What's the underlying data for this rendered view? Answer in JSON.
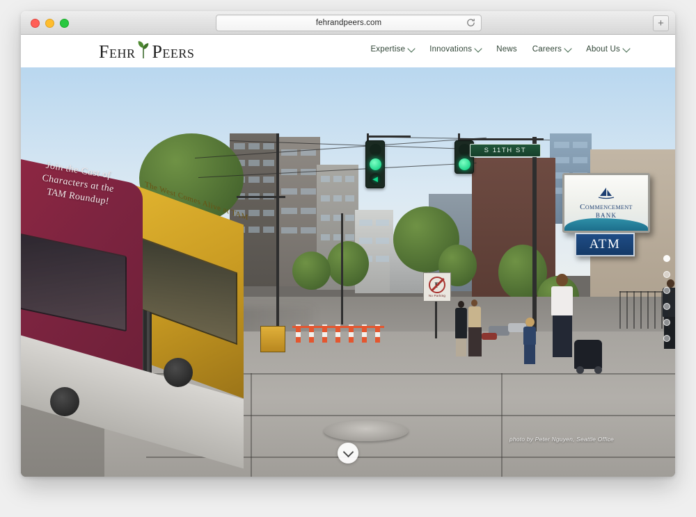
{
  "browser": {
    "url": "fehrandpeers.com",
    "reload_icon": "reload-icon",
    "new_tab_label": "+",
    "traffic_lights": [
      "close",
      "minimize",
      "zoom"
    ]
  },
  "site": {
    "logo": {
      "word1": "Fehr",
      "word2": "Peers",
      "mark": "leaf-mark"
    },
    "nav": [
      {
        "label": "Expertise",
        "has_dropdown": true
      },
      {
        "label": "Innovations",
        "has_dropdown": true
      },
      {
        "label": "News",
        "has_dropdown": false
      },
      {
        "label": "Careers",
        "has_dropdown": true
      },
      {
        "label": "About Us",
        "has_dropdown": true
      }
    ],
    "nav_color": "#2f4435"
  },
  "hero": {
    "photo_credit": "photo by Peter Nguyen, Seattle Office",
    "scroll_hint_icon": "chevron-down-icon",
    "slide_dots": 6,
    "active_dot": 0,
    "scene": {
      "tram_ad_line1": "Join the Cast of",
      "tram_ad_line2": "Characters at the",
      "tram_ad_line3": "TAM Roundup!",
      "tram_gold_text": "The West Comes Alive at TAM",
      "street_sign": "S 11TH ST",
      "bank_sign_name": "Commencement",
      "bank_sign_sub": "BANK",
      "bank_logo_icon": "sailboat-icon",
      "atm_sign": "ATM",
      "no_parking_symbol": "P",
      "no_parking_text": "No Parking",
      "signal_left_state": "green",
      "signal_left_arrow": "◄",
      "signal_right_state": "green"
    }
  }
}
